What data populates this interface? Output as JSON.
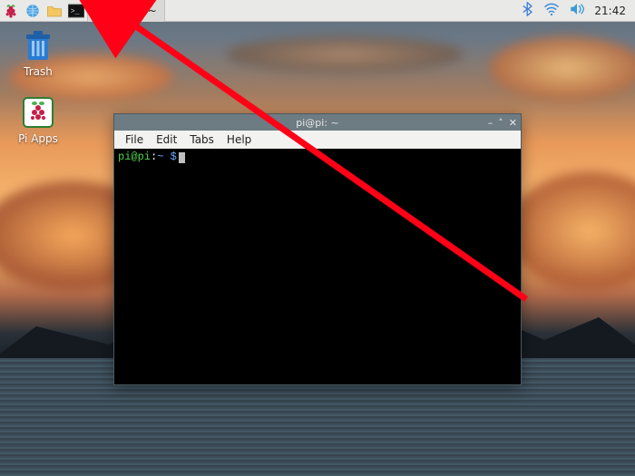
{
  "taskbar": {
    "task_button_label": "pi@pi: ~",
    "clock": "21:42"
  },
  "desktop_icons": {
    "trash": {
      "label": "Trash"
    },
    "piapps": {
      "label": "Pi Apps"
    }
  },
  "terminal": {
    "title": "pi@pi: ~",
    "menu": {
      "file": "File",
      "edit": "Edit",
      "tabs": "Tabs",
      "help": "Help"
    },
    "prompt_userhost": "pi@pi",
    "prompt_path": "~",
    "prompt_symbol": "$"
  }
}
